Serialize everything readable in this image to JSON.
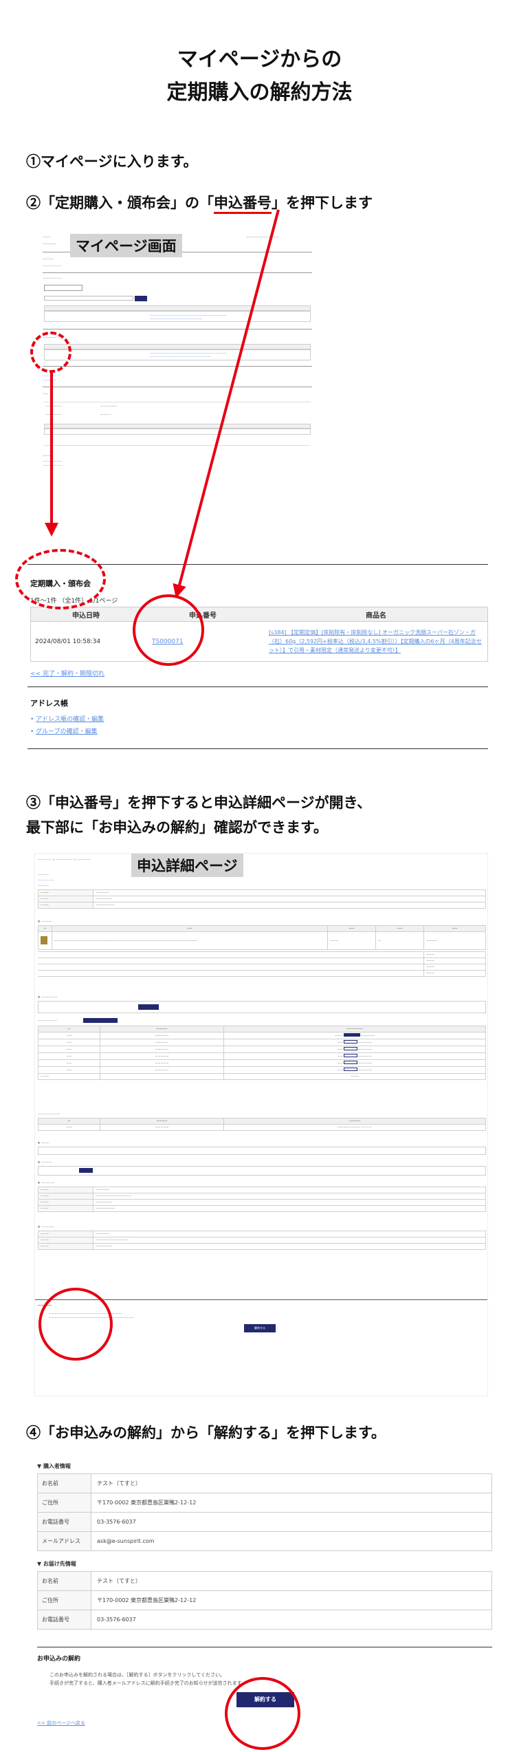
{
  "title": {
    "line1": "マイページからの",
    "line2": "定期購入の解約方法"
  },
  "steps": {
    "s1": "①マイページに入ります。",
    "s2_pre": "②「定期購入・頒布会」の「",
    "s2_hl": "申込番号",
    "s2_post": "」を押下します",
    "s3_l1": "③「申込番号」を押下すると申込詳細ページが開き、",
    "s3_l2": "最下部に「お申込みの解約」確認ができます。",
    "s4": "④「お申込みの解約」から「解約する」を押下します。"
  },
  "mypage": {
    "badge": "マイページ画面",
    "section_title": "定期購入・頒布会",
    "paging": "1件〜1件 （全1件） 1/1ページ",
    "col_date": "申込日時",
    "col_no": "申込番号",
    "col_product": "商品名",
    "row_date": "2024/08/01 10:58:34",
    "row_no": "TS000071",
    "row_product": "[s384] 【定期定価】[床削除有・床削除なし] オーガニック洗顔スーパー石ゾン・ガ（石）60g（2,592円+税率込（税込/3,4.5%割引））【定期購入の6ヶ月（4周年記念セット）】で引用・素材限定（通常発送より変更不可）】",
    "more_link": "<< 完了・解約・期限切れ",
    "address_title": "アドレス帳",
    "address_link1": "アドレス帳の確認・編集",
    "address_link2": "グループの確認・編集"
  },
  "detail": {
    "badge": "申込詳細ページ",
    "cancel_button": "解約する"
  },
  "final": {
    "buyer_title": "▼ 購入者情報",
    "buyer": [
      {
        "label": "お名前",
        "value": "テスト（てすと）"
      },
      {
        "label": "ご住所",
        "value": "〒170-0002 東京都豊島区巣鴨2-12-12"
      },
      {
        "label": "お電話番号",
        "value": "03-3576-6037"
      },
      {
        "label": "メールアドレス",
        "value": "ask@e-sunspirit.com"
      }
    ],
    "ship_title": "▼ お届け先情報",
    "ship": [
      {
        "label": "お名前",
        "value": "テスト（てすと）"
      },
      {
        "label": "ご住所",
        "value": "〒170-0002 東京都豊島区巣鴨2-12-12"
      },
      {
        "label": "お電話番号",
        "value": "03-3576-6037"
      }
    ],
    "cancel_title": "お申込みの解約",
    "cancel_text1": "このお申込みを解約される場合は、［解約する］ボタンをクリックしてください。",
    "cancel_text2": "手続きが完了すると、購入者メールアドレスに解約手続き完了のお知らせが送信されます。",
    "cancel_button": "解約する",
    "back_link": "<< 前のページへ戻る"
  },
  "colors": {
    "arrow": "#e60012",
    "navy": "#22286e",
    "link": "#5b8ee0"
  }
}
